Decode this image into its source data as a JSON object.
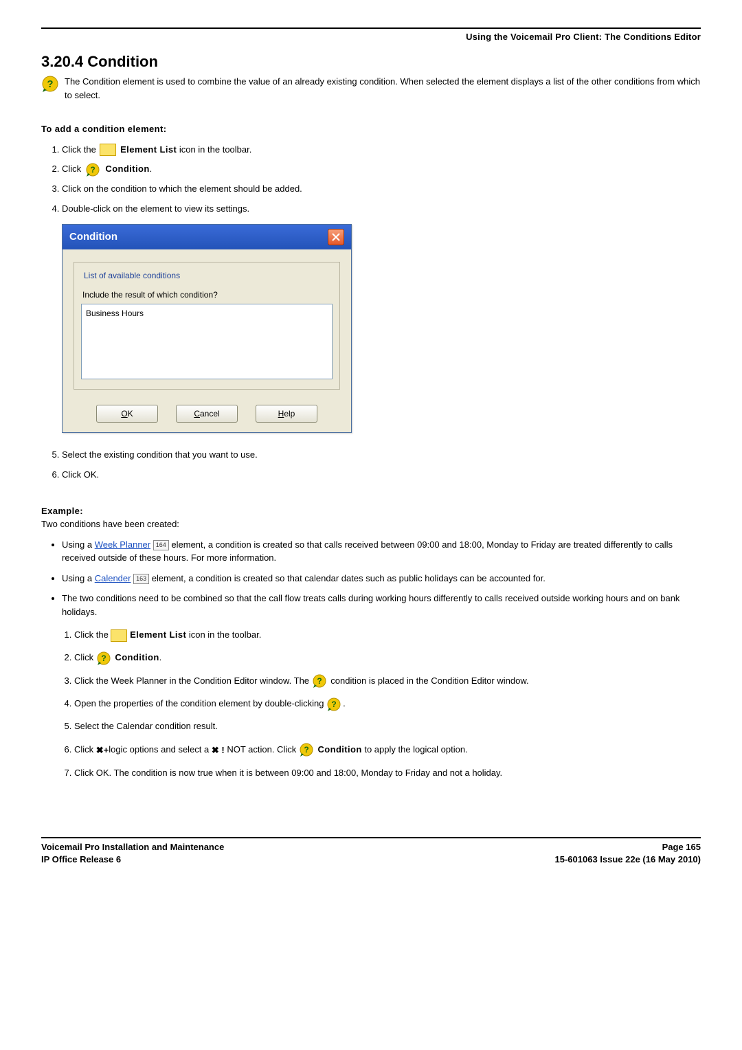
{
  "header": {
    "right": "Using the Voicemail Pro Client: The Conditions Editor"
  },
  "section": {
    "number": "3.20.4",
    "title": "Condition",
    "intro": "The Condition element is used to combine the value of an already existing condition. When selected the element displays a list of the other conditions from which to select.",
    "subhead": "To add a condition element:",
    "steps": {
      "s1a": "Click the",
      "s1b": "Element List",
      "s1c": " icon in the toolbar.",
      "s2a": "Click",
      "s2b": "Condition",
      "s2c": ".",
      "s3": "Click on the condition to which the element should be added.",
      "s4": "Double-click on the element to view its settings.",
      "s5": "Select the existing condition that you want to use.",
      "s6": "Click OK."
    },
    "example_head": "Example:",
    "example_intro": "Two conditions have been created:",
    "bullets": {
      "b1a": "Using a ",
      "b1_link": "Week Planner",
      "b1_ref": "164",
      "b1b": " element, a condition is created so that calls received between 09:00 and 18:00, Monday to Friday are treated differently to calls received outside of these hours. For more information.",
      "b2a": "Using a ",
      "b2_link": "Calender",
      "b2_ref": "163",
      "b2b": " element, a condition is created so that calendar dates such as public holidays can be accounted for.",
      "b3": "The two conditions need to be combined so that the call flow treats calls during working hours differently to calls received outside working hours and on bank holidays."
    },
    "inner": {
      "s1a": "Click the",
      "s1b": "Element List",
      "s1c": " icon in the toolbar.",
      "s2a": "Click",
      "s2b": "Condition",
      "s2c": ".",
      "s3a": "Click the Week Planner in the Condition Editor window. The ",
      "s3b": " condition is placed in the Condition Editor window.",
      "s4a": "Open the properties of the condition element by double-clicking ",
      "s4b": ".",
      "s5": "Select the Calendar condition result.",
      "s6a": "Click ",
      "s6b": "logic options and select a ",
      "s6c": " NOT action. Click ",
      "s6d": "Condition",
      "s6e": " to apply the logical option.",
      "s7": "Click OK. The condition is now true when it is between 09:00 and 18:00, Monday to Friday and not a holiday."
    }
  },
  "dialog": {
    "title": "Condition",
    "legend": "List of available conditions",
    "question": "Include the result of which condition?",
    "item1": "Business Hours",
    "ok": "OK",
    "cancel": "Cancel",
    "help": "Help"
  },
  "footer": {
    "l1": "Voicemail Pro Installation and Maintenance",
    "l2": "IP Office Release 6",
    "r1": "Page 165",
    "r2": "15-601063 Issue 22e (16 May 2010)"
  },
  "icons": {
    "cond_colors": {
      "outer": "#f0c808",
      "inner": "#1c8a16",
      "q": "#176b12"
    }
  }
}
